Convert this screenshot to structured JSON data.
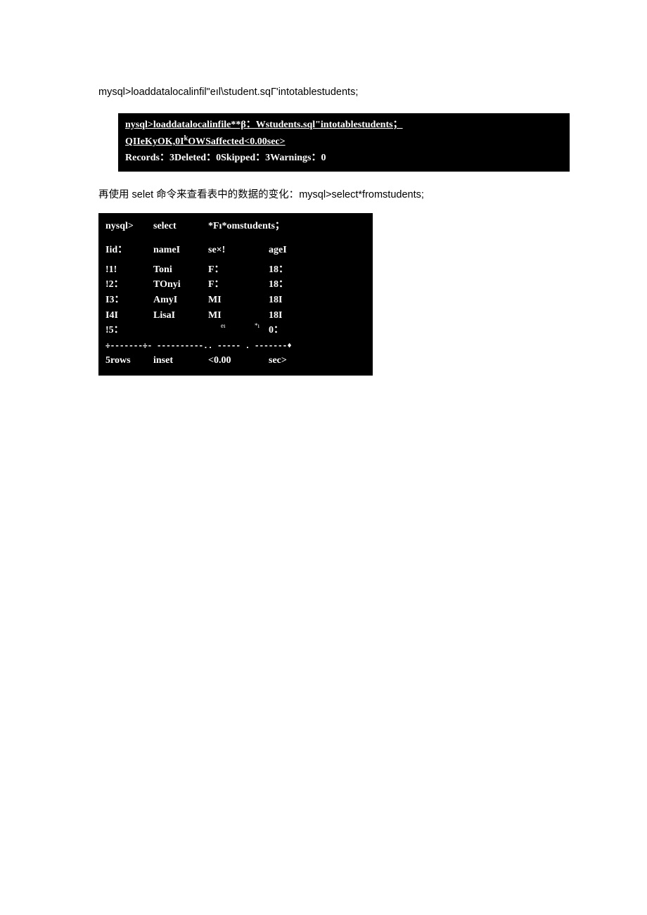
{
  "text": {
    "line1": "mysql>loaddatalocalinfil\"eıl\\student.sqΓ'intotablestudents;",
    "line3_prefix": "再使用 selet 命令来查看表中的数据的变化：",
    "line3_cmd": "mysql>select*fromstudents;"
  },
  "block1": {
    "l1_a": "nysql>loaddatalocalinfile**β：Wstudents.sql\"intotablestudents；QIIeKyOK,0I",
    "l1_sup": "k",
    "l1_b": "OWSaffected<0.00sec>",
    "l2": "Records：3Deleted：0Skipped：3Warnings：0"
  },
  "block2": {
    "prompt": {
      "p": "nysql>",
      "s": "select",
      "q": "*Fı*omstudents；"
    },
    "header": {
      "c1": "Iid：",
      "c2": "nameI",
      "c3": "se×!",
      "c4": "ageI"
    },
    "rows": [
      {
        "c1": "!1!",
        "c2": "Toni",
        "c3": "F：",
        "c4": "18："
      },
      {
        "c1": "!2：",
        "c2": "TOnyi",
        "c3": "F：",
        "c4": "18："
      },
      {
        "c1": "I3：",
        "c2": "AmyI",
        "c3": "MI",
        "c4": "18I"
      },
      {
        "c1": "I4I",
        "c2": "LisaI",
        "c3": "MI",
        "c4": "18I"
      },
      {
        "c1": "!5：",
        "c2": "",
        "c3": "",
        "c4": "0："
      }
    ],
    "tiny": {
      "a": "eı",
      "b": "*ı"
    },
    "sep": "÷-------÷- ----------.. ----- . -------♦",
    "footer": {
      "c1": "5rows",
      "c2": "inset",
      "c3": "<0.00",
      "c4": "sec>"
    }
  }
}
